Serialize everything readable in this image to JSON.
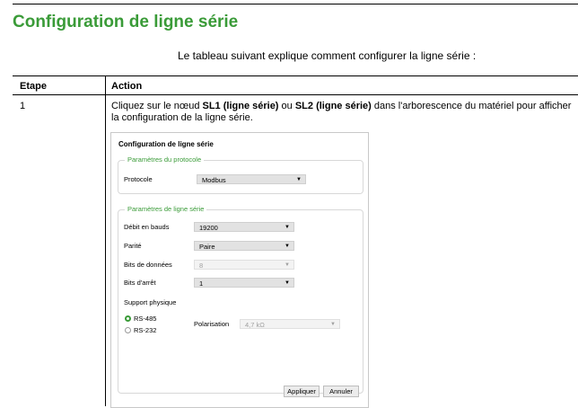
{
  "page": {
    "title": "Configuration de ligne série",
    "intro": "Le tableau suivant explique comment configurer la ligne série :"
  },
  "table": {
    "headers": [
      "Etape",
      "Action"
    ],
    "row": {
      "step": "1",
      "desc_parts": [
        "Cliquez sur le nœud ",
        "SL1 (ligne série)",
        " ou ",
        "SL2 (ligne série)",
        " dans l'arborescence du matériel pour afficher la configuration de la ligne série."
      ]
    }
  },
  "dialog": {
    "title": "Configuration de ligne série",
    "protocol_group": {
      "legend": "Paramètres du protocole",
      "protocol_label": "Protocole",
      "protocol_value": "Modbus"
    },
    "line_group": {
      "legend": "Paramètres de ligne série",
      "baud_label": "Débit en bauds",
      "baud_value": "19200",
      "parity_label": "Parité",
      "parity_value": "Paire",
      "databits_label": "Bits de données",
      "databits_value": "8",
      "stopbits_label": "Bits d'arrêt",
      "stopbits_value": "1",
      "support_label": "Support physique",
      "rs485_label": "RS-485",
      "rs232_label": "RS-232",
      "polarisation_label": "Polarisation",
      "polarisation_value": "4,7 kΩ",
      "selected_support": "RS-485"
    },
    "apply_label": "Appliquer",
    "cancel_label": "Annuler"
  },
  "icons": {
    "dropdown": "chevron-down-icon"
  },
  "colors": {
    "accent": "#3a9b38"
  }
}
